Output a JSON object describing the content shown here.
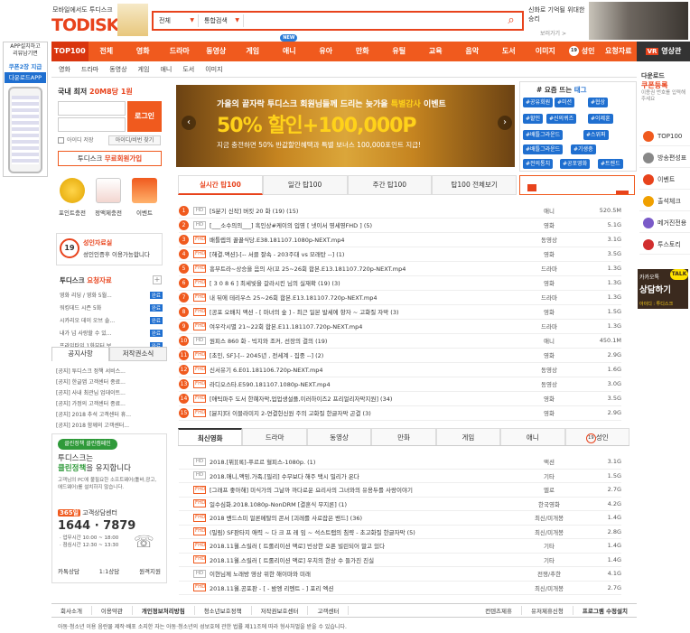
{
  "header": {
    "logo_sub": "모바일에서도 투디스크",
    "logo": "TODISK",
    "search": {
      "scope": "전체",
      "type": "통합검색",
      "value": ""
    },
    "ad_text": "신화로 기억될 위대한 승리",
    "ad_link": "보러가기 >"
  },
  "nav": {
    "items": [
      "TOP100",
      "전체",
      "영화",
      "드라마",
      "동영상",
      "게임",
      "애니",
      "유아",
      "만화",
      "유틸",
      "교육",
      "음악",
      "도서",
      "이미지",
      "성인",
      "요청자료"
    ],
    "new_badge": "NEW",
    "adult_badge": "19",
    "vr_label": "영상관",
    "vr_badge": "VR",
    "subnav": [
      "영화",
      "드라마",
      "동영상",
      "게임",
      "애니",
      "도서",
      "이미지"
    ]
  },
  "app": {
    "line1": "APP설치하고",
    "line2": "리뷰남기면",
    "coupon": "쿠폰2장 지급",
    "download": "다운로드APP"
  },
  "login": {
    "title_prefix": "국내 최저 ",
    "title_highlight": "20M8당 1원",
    "button": "로그인",
    "save_id": "아이디 저장",
    "find": "아이디/비번 찾기",
    "signup_prefix": "투디스크 ",
    "signup_highlight": "무료회원가입"
  },
  "quick": [
    "포인트충전",
    "정액제충전",
    "이벤트"
  ],
  "adult": {
    "badge": "19",
    "title": "성인자료실",
    "sub": "성인인증후 이용가능합니다"
  },
  "requests": {
    "title_prefix": "투디스크 ",
    "title_highlight": "요청자료",
    "plus": "+",
    "badge": "완료",
    "items": [
      "영화 리딩 / 영화 5월...",
      "워킹데드 시즌 5화",
      "시카리오 데이 오브 솔...",
      "내가 넘 사랑할 수 있...",
      "프라임타임 1화부터 보..."
    ]
  },
  "notice": {
    "tabs": [
      "공지사항",
      "저작권소식"
    ],
    "items": [
      "[공지] 투디스크 정책 서비스...",
      "[공지] 한글앱 고객센터 종료...",
      "[공지] 사내 최관님 업데이트...",
      "[공지] 가정의 고객센터 종료...",
      "[공지] 2018 추석 고객센터 휴...",
      "[공지] 2018 함께의 고객센터..."
    ]
  },
  "clean": {
    "badge": "클린정책 클린캠페인",
    "t1": "투디스크는",
    "t2_highlight": "클린정책",
    "t2_rest": "을 유지합니다",
    "t3": "고객님의 PC에 불필요한 소프트웨어(툴바,광고, 애드웨어)를 설치하지 않습니다.",
    "cs_badge": "365일",
    "cs_title": "고객상담센터",
    "phone": "1644 · 7879",
    "hours1": "· 업무시간 10:00 ~ 18:00",
    "hours2": "· 점심시간 12:30 ~ 13:30",
    "links": [
      "카톡상담",
      "1:1상담",
      "원격지원"
    ]
  },
  "banner": {
    "t1_prefix": "가을의 끝자락 투디스크 회원님들께 드리는 늦가을 ",
    "t1_highlight": "특별감사",
    "t1_suffix": " 이벤트",
    "t2": "50% 할인+100,000P",
    "t3": "지금 충전하면 50% 반값할인혜택과 특별 보너스 100,000포인트 지급!"
  },
  "tags": {
    "title_prefix": "# 요즘 뜨는 ",
    "title_highlight": "태그",
    "items": [
      "#공유회원",
      "#미션",
      "#협상",
      "#할인",
      "#신의퀴즈",
      "#이제훈",
      "#배틀그라운드",
      "#스위퍼",
      "#배틀그라운드",
      "#기생충",
      "#블랙팬서",
      "#전의통치",
      "#공포영화",
      "#우리가사는",
      "#트렌드"
    ]
  },
  "right": {
    "coupon_t1": "다운로드",
    "coupon_t2": "쿠폰등록",
    "coupon_t3": "이용권 번호를 입력해주세요",
    "items": [
      "TOP100",
      "방송편성표",
      "이벤트",
      "출석체크",
      "메거진전용",
      "투스토리"
    ],
    "kakao_t1": "카카오톡",
    "kakao_t2": "상담하기",
    "kakao_t3": "아이디 : 투디스크",
    "kakao_talk": "TALK"
  },
  "top100": {
    "tabs": [
      "실시간 탑100",
      "일간 탑100",
      "주간 탑100",
      "탑100 전체보기"
    ],
    "rows": [
      {
        "n": "1",
        "q": "HD",
        "title": "[S분기 신작] 버킷 20 화 (19) (15)",
        "cat": "애니",
        "size": "520.5M"
      },
      {
        "n": "2",
        "q": "HD",
        "title": "[___소수의의___] 흑인상#케이의 입영 [ 넷이서 영세영FHD ] (5)",
        "cat": "영화",
        "size": "5.1G"
      },
      {
        "n": "3",
        "q": "FHD",
        "title": "배틀렙의 꿀꿀식당.E38.181107.1080p-NEXT.mp4",
        "cat": "동영상",
        "size": "3.1G"
      },
      {
        "n": "4",
        "q": "FHD",
        "title": "[해결.액션]-[-- 서클 잘속 - 203주대 vs 모래탄 --] (1)",
        "cat": "영화",
        "size": "3.5G"
      },
      {
        "n": "5",
        "q": "FHD",
        "title": "흥부트라~상승을 음의 사(꼬 25~26회 합본.E13.181107.720p-NEXT.mp4",
        "cat": "드라마",
        "size": "1.3G"
      },
      {
        "n": "6",
        "q": "FHD",
        "title": "[ 3 0 8 6 ] 최세빛을 갈라시킨 님의 실재확 (19) (3)",
        "cat": "영화",
        "size": "1.3G"
      },
      {
        "n": "7",
        "q": "FHD",
        "title": "내 뒤에 테리우스 25~26회 합본.E13.181107.720p-NEXT.mp4",
        "cat": "드라마",
        "size": "1.3G"
      },
      {
        "n": "8",
        "q": "FHD",
        "title": "[공포 오배치 액션 - [ 마녀의 숲 ] - 최근 일본 발세에 항자 ~ 고화질 자막 (3)",
        "cat": "영화",
        "size": "1.5G"
      },
      {
        "n": "9",
        "q": "FHD",
        "title": "여우각시별 21~22회 합본.E11.181107.720p-NEXT.mp4",
        "cat": "드라마",
        "size": "1.3G"
      },
      {
        "n": "10",
        "q": "HD",
        "title": "원피스 860 화 - 빅지와 조커, 선장의 결의 (19)",
        "cat": "애니",
        "size": "450.1M"
      },
      {
        "n": "11",
        "q": "FHD",
        "title": "[초인, SF]-[-- 2045년 , 전세계 - 집중 --] (2)",
        "cat": "영화",
        "size": "2.9G"
      },
      {
        "n": "12",
        "q": "FHD",
        "title": "신서유기 6.E01.181106.720p-NEXT.mp4",
        "cat": "동영상",
        "size": "1.6G"
      },
      {
        "n": "13",
        "q": "FHD",
        "title": "라디오스타.E590.181107.1080p-NEXT.mp4",
        "cat": "동영상",
        "size": "3.0G"
      },
      {
        "n": "14",
        "q": "FHD",
        "title": "[애틱파주 도서 한혜자막,업업생설플,이러하이즈2 프리얼리자막지원] (34)",
        "cat": "영화",
        "size": "3.5G"
      },
      {
        "n": "15",
        "q": "FHD",
        "title": "[뷴지]더 이블라미지 2-연결헌신원 주의 고화질 한글자막 곤결 (3)",
        "cat": "영화",
        "size": "2.9G"
      }
    ]
  },
  "recent": {
    "tabs": [
      "최신영화",
      "드라마",
      "동영상",
      "만화",
      "게임",
      "애니",
      "성인"
    ],
    "adult_badge": "19",
    "rows": [
      {
        "q": "HD",
        "title": "2018.[뷔][록]-푸르르 혈피스-1080p. (1)",
        "cat": "액션",
        "size": "3.1G"
      },
      {
        "q": "HD",
        "title": "2018.애니,액밍.가족.[필리] 수무보다 해주 택시 밀리가 온다",
        "cat": "기타",
        "size": "1.5G"
      },
      {
        "q": "FHD",
        "title": "[그래프 좋아해] 미식가의 그날까 까다로운 요리사의 그녀와의 유용두를 사랑이야기",
        "cat": "멜로",
        "size": "2.7G"
      },
      {
        "q": "FHD",
        "title": "일수심화.2018.1080p-NonDRM [결혼식 무지론] (1)",
        "cat": "한국영화",
        "size": "4.2G"
      },
      {
        "q": "FHD",
        "title": "2018 밴드스미 얼론메탈의 콘서 [괴레를 사로잡은 밴드] (36)",
        "cat": "최신/미개봉",
        "size": "1.4G"
      },
      {
        "q": "FHD",
        "title": "(밀림) SF판타지 애력 ~ 다 크 프 레 임 ~ 석스트랩의 침략 - 초고화질 한글자막 (5)",
        "cat": "최신/미개봉",
        "size": "2.8G"
      },
      {
        "q": "FHD",
        "title": "2018.11월.스릴러 [ 트롤리이션 액로] 빈상한 오픈 빌린되어 말고 있다",
        "cat": "기타",
        "size": "1.4G"
      },
      {
        "q": "FHD",
        "title": "2018.11월.스릴러 [ 트롤리이션 액로] 우치의 한상 수 들가진 진실",
        "cat": "기타",
        "size": "1.4G"
      },
      {
        "q": "HD",
        "title": "이현님께 노래방 영상 위한 해이마와 미래",
        "cat": "전쟁/추한",
        "size": "4.1G"
      },
      {
        "q": "FHD",
        "title": "2018.11월.공포판 - [ - 밤엥 리멘트 - ] 포리 엑션",
        "cat": "최신/미개봉",
        "size": "2.7G"
      }
    ]
  },
  "footer": {
    "links": [
      "회사소개",
      "이용약관",
      "개인정보처리방침",
      "청소년보호정책",
      "저작권보호센터",
      "고객센터",
      "컨텐츠제휴",
      "유저제휴신청",
      "프로그램 수정설치"
    ],
    "notice": "아동·청소년 이용 음란물 제작·배포 소지한 자는 아동·청소년의 성보호에 관한 법률 제11조에 따라 형사처벌을 받을 수 있습니다."
  },
  "colors": {
    "accent": "#f05a1e",
    "blue": "#1f6fd0",
    "green": "#2f9a3a"
  }
}
